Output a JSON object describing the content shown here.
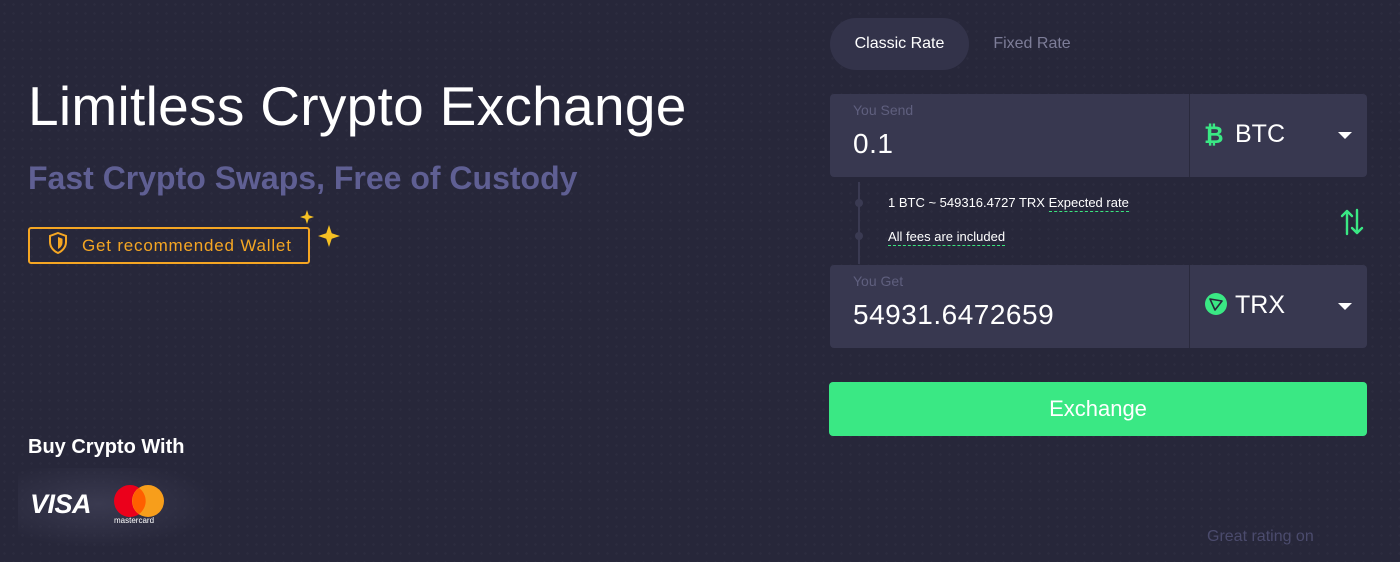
{
  "hero": {
    "title": "Limitless Crypto Exchange",
    "subtitle": "Fast Crypto Swaps, Free of Custody",
    "wallet_button": "Get recommended Wallet"
  },
  "buy": {
    "title": "Buy Crypto With",
    "methods": [
      "VISA",
      "mastercard"
    ]
  },
  "tabs": {
    "classic": "Classic Rate",
    "fixed": "Fixed Rate",
    "active": "Classic Rate"
  },
  "send": {
    "label": "You Send",
    "value": "0.1",
    "currency": "BTC",
    "currency_icon": "bitcoin-icon"
  },
  "rate": {
    "text": "1 BTC ~ 549316.4727 TRX",
    "expected_link": "Expected rate",
    "fees_link": "All fees are included"
  },
  "get": {
    "label": "You Get",
    "value": "54931.6472659",
    "currency": "TRX",
    "currency_icon": "tron-icon"
  },
  "exchange_button": "Exchange",
  "rating_text": "Great rating on",
  "colors": {
    "background": "#27273a",
    "accent_green": "#3ae884",
    "wallet_orange": "#f5a623",
    "subtitle": "#5f5f93",
    "field": "#383850"
  }
}
